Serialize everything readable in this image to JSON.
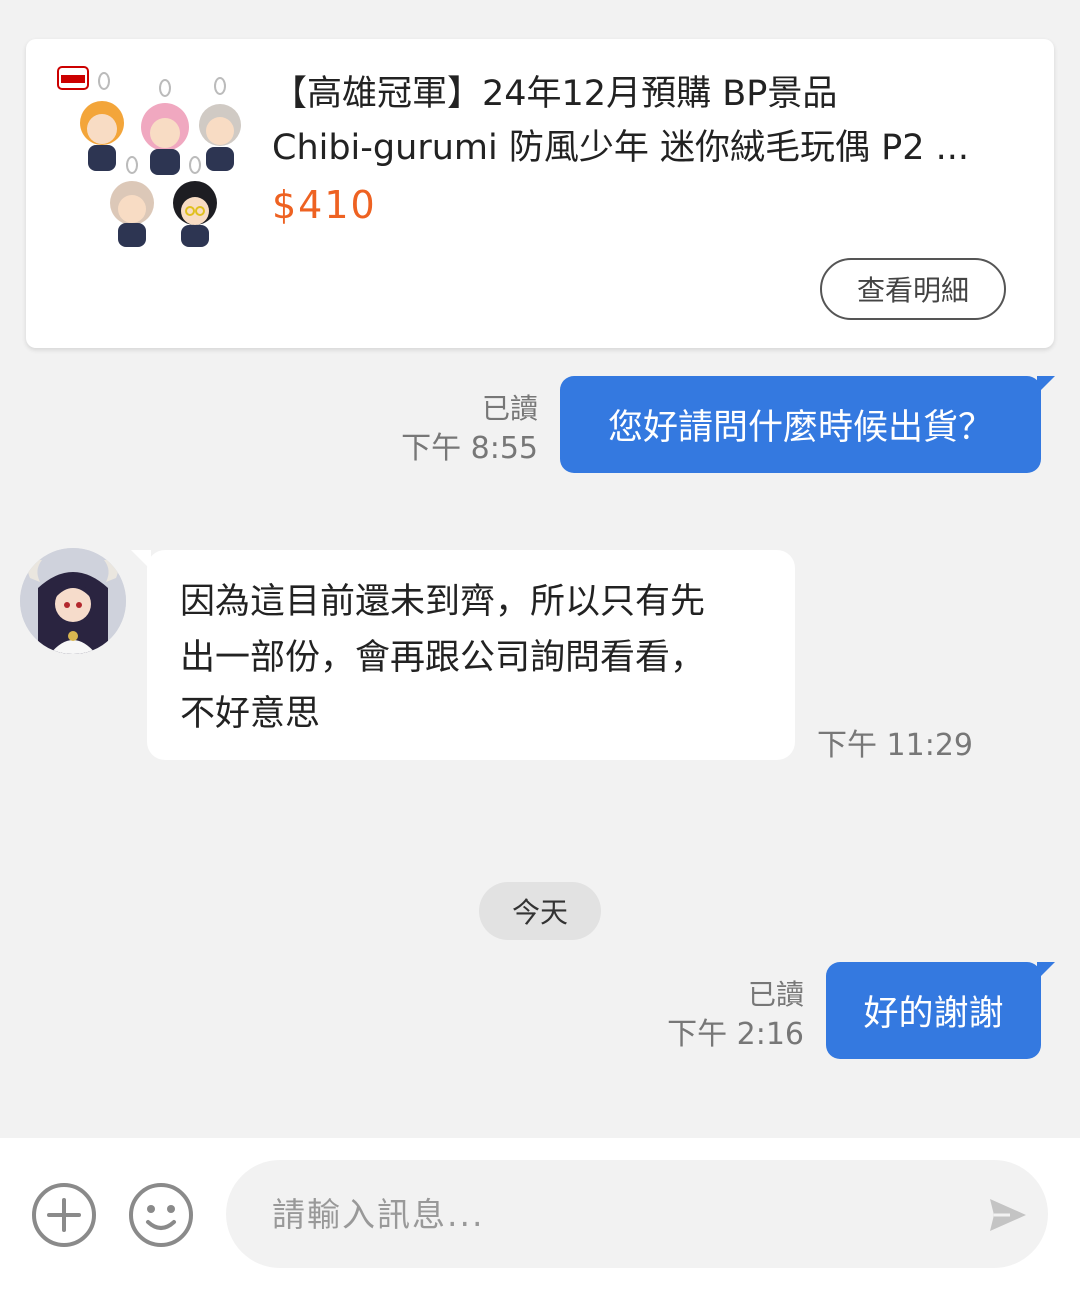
{
  "product": {
    "title_line1": "【高雄冠軍】24年12月預購 BP景品",
    "title_line2": "Chibi-gurumi 防風少年 迷你絨毛玩偶 P2 ...",
    "price": "$410",
    "details_button": "查看明細",
    "image_icon": "plush-keychains-image"
  },
  "messages": [
    {
      "direction": "outgoing",
      "text": "您好請問什麼時候出貨？",
      "read_status": "已讀",
      "time": "下午 8:55"
    },
    {
      "direction": "incoming",
      "text": "因為這目前還未到齊，所以只有先\n出一部份，會再跟公司詢問看看，\n不好意思",
      "time": "下午 11:29",
      "avatar_icon": "seller-avatar"
    },
    {
      "direction": "outgoing",
      "text": "好的謝謝",
      "read_status": "已讀",
      "time": "下午 2:16"
    }
  ],
  "date_separator": "今天",
  "composer": {
    "placeholder": "請輸入訊息...",
    "add_icon": "plus-circle-icon",
    "emoji_icon": "smiley-icon",
    "send_icon": "send-icon"
  },
  "colors": {
    "outgoing_bubble": "#3479e0",
    "price": "#ee6222",
    "background": "#f2f2f2"
  }
}
